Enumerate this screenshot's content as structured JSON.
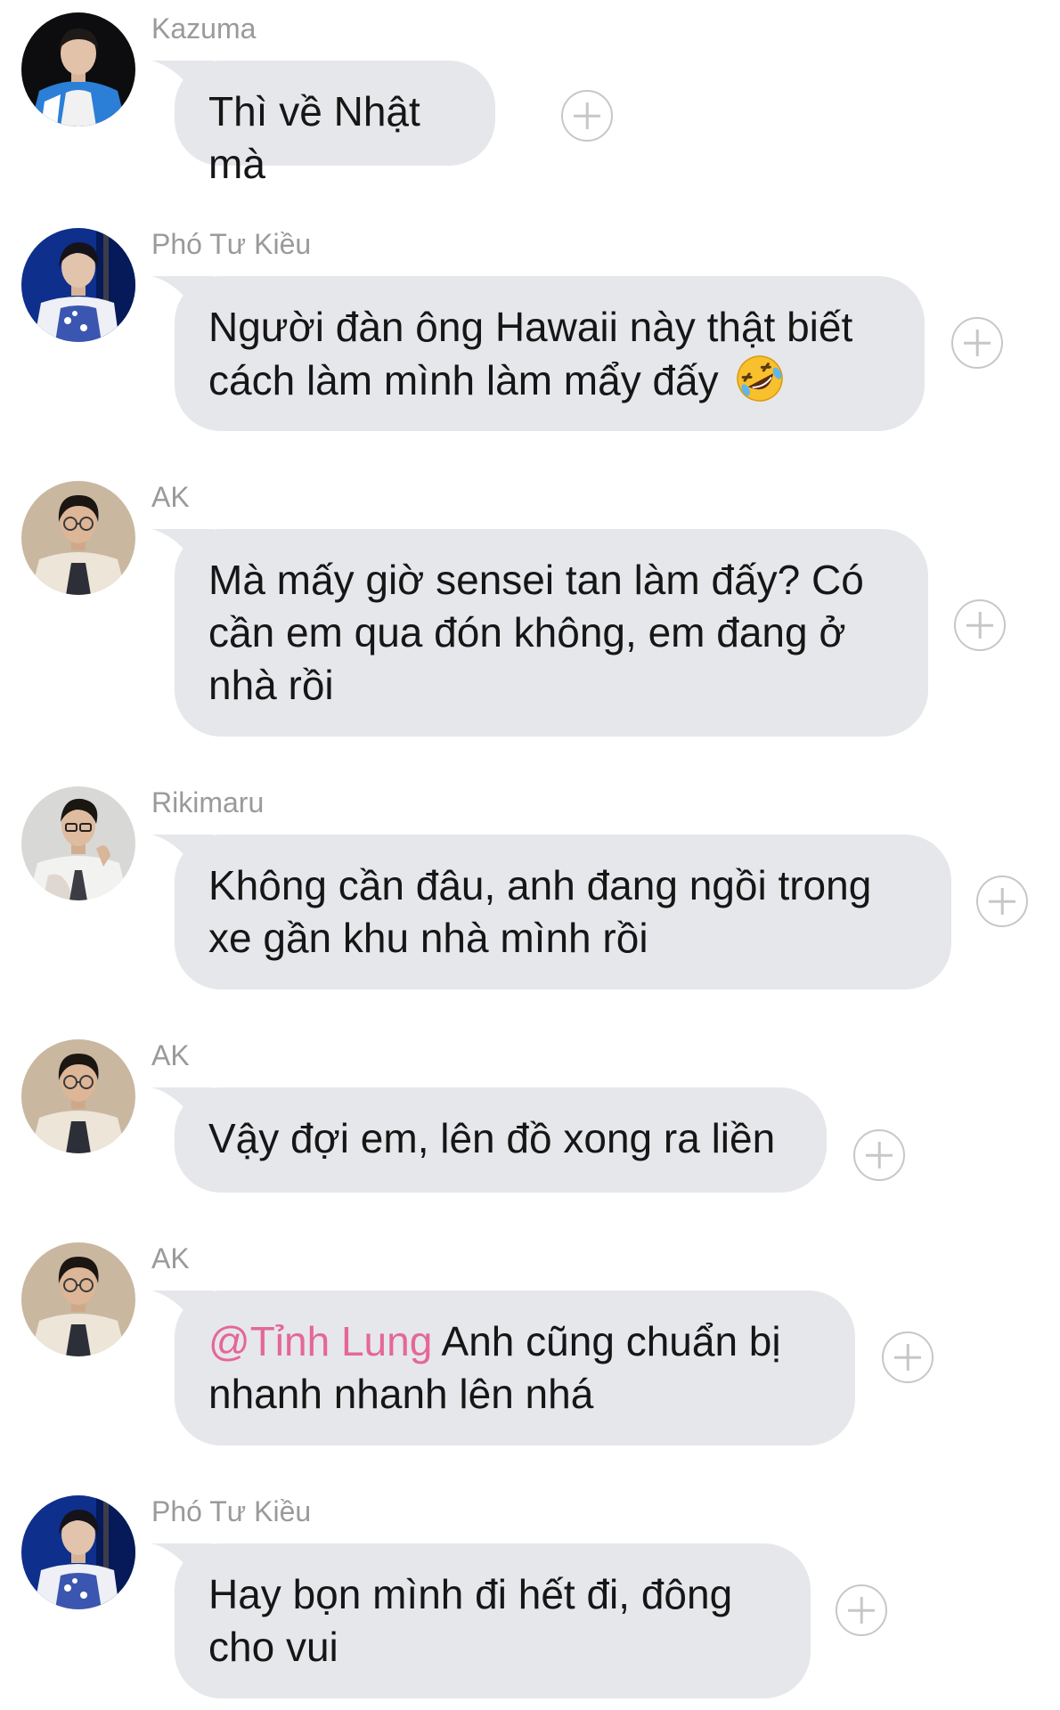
{
  "messages": [
    {
      "sender": "Kazuma",
      "text": "Thì về Nhật mà",
      "avatar": "kazuma"
    },
    {
      "sender": "Phó Tư Kiều",
      "text": "Người đàn ông Hawaii này thật biết cách làm mình làm mẩy đấy",
      "emoji": "rolling-on-floor-laughing",
      "avatar": "pho-tu-kieu"
    },
    {
      "sender": "AK",
      "text": "Mà mấy giờ sensei tan làm đấy? Có cần em qua đón không, em đang ở nhà rồi",
      "avatar": "ak"
    },
    {
      "sender": "Rikimaru",
      "text": "Không cần đâu, anh đang ngồi trong xe gần khu nhà mình rồi",
      "avatar": "rikimaru"
    },
    {
      "sender": "AK",
      "text": "Vậy đợi em, lên đồ xong ra liền",
      "avatar": "ak"
    },
    {
      "sender": "AK",
      "mention": "@Tỉnh Lung",
      "text": " Anh cũng chuẩn bị nhanh nhanh lên nhá",
      "avatar": "ak"
    },
    {
      "sender": "Phó Tư Kiều",
      "text": "Hay bọn mình đi hết đi, đông cho vui",
      "avatar": "pho-tu-kieu"
    }
  ],
  "colors": {
    "bubble": "#e6e7ea",
    "sender_name": "#9a9a9a",
    "message_text": "#161616",
    "mention": "#e4679a",
    "react_icon": "#c7c7c7"
  },
  "icons": {
    "react_button": "add-reaction-icon"
  }
}
